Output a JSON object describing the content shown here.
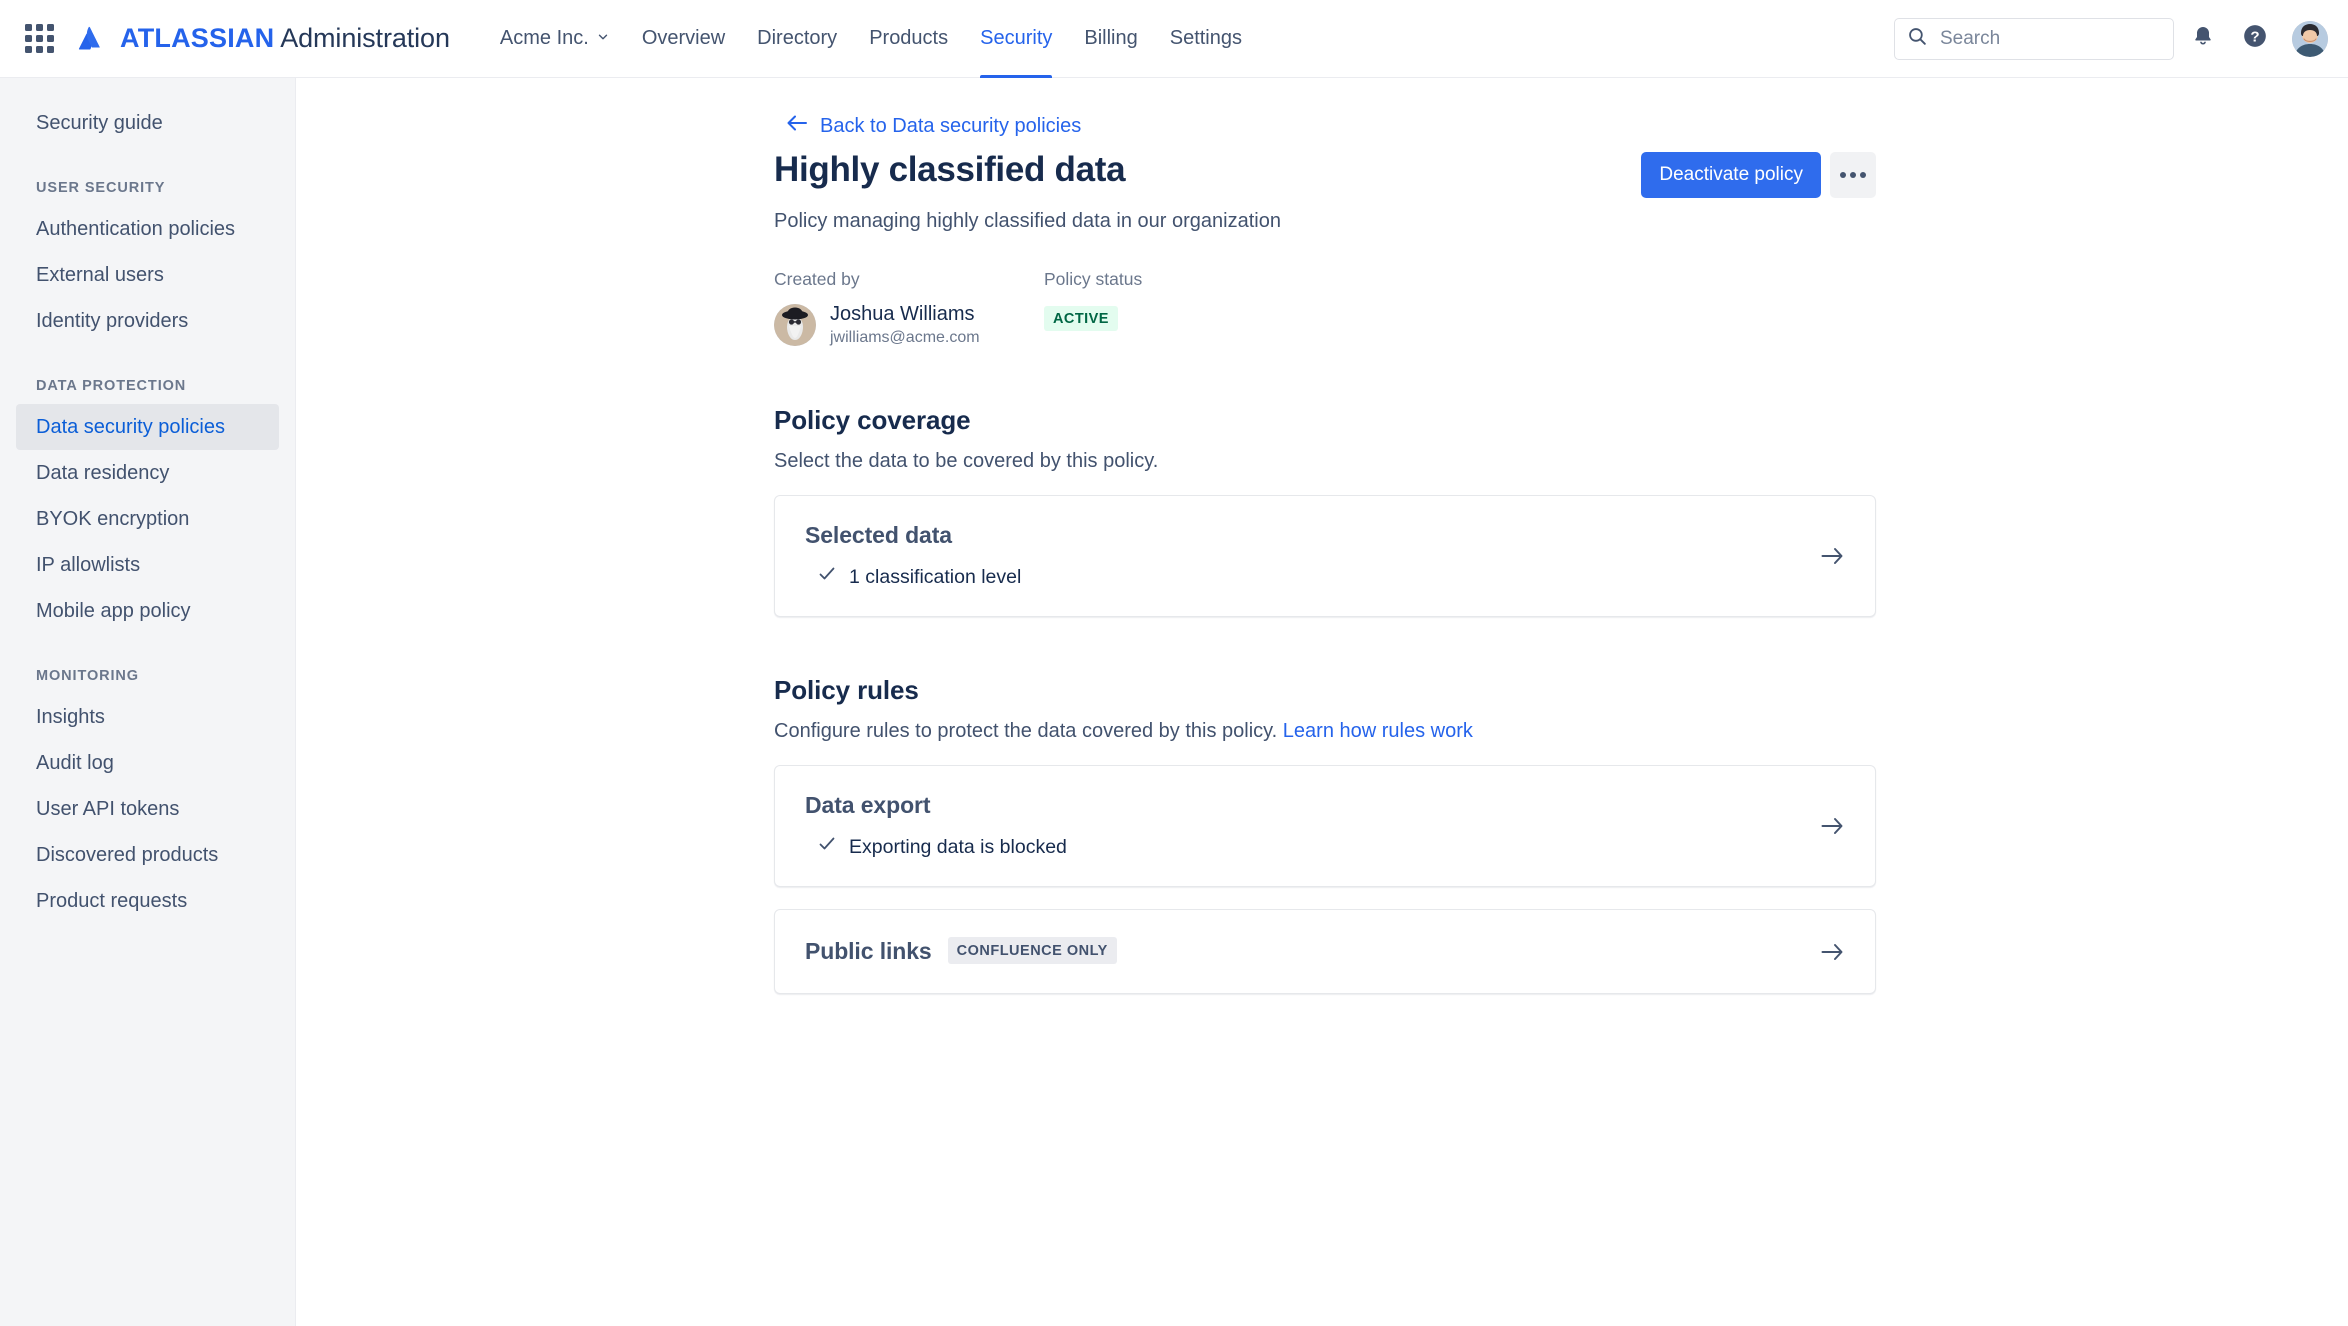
{
  "topnav": {
    "app_switcher_icon": "grid-apps-icon",
    "logo_icon": "atlassian-logo-icon",
    "brand_bold": "ATLASSIAN",
    "brand_light": "Administration",
    "org_name": "Acme Inc.",
    "links": [
      {
        "label": "Overview",
        "active": false
      },
      {
        "label": "Directory",
        "active": false
      },
      {
        "label": "Products",
        "active": false
      },
      {
        "label": "Security",
        "active": true
      },
      {
        "label": "Billing",
        "active": false
      },
      {
        "label": "Settings",
        "active": false
      }
    ],
    "search": {
      "placeholder": "Search",
      "value": "",
      "icon": "search-icon"
    },
    "notifications_icon": "bell-icon",
    "help_icon": "question-circle-icon",
    "profile_icon": "user-avatar"
  },
  "sidebar": {
    "top_items": [
      {
        "label": "Security guide",
        "selected": false
      }
    ],
    "groups": [
      {
        "title": "USER SECURITY",
        "items": [
          {
            "label": "Authentication policies",
            "selected": false
          },
          {
            "label": "External users",
            "selected": false
          },
          {
            "label": "Identity providers",
            "selected": false
          }
        ]
      },
      {
        "title": "DATA PROTECTION",
        "items": [
          {
            "label": "Data security policies",
            "selected": true
          },
          {
            "label": "Data residency",
            "selected": false
          },
          {
            "label": "BYOK encryption",
            "selected": false
          },
          {
            "label": "IP allowlists",
            "selected": false
          },
          {
            "label": "Mobile app policy",
            "selected": false
          }
        ]
      },
      {
        "title": "MONITORING",
        "items": [
          {
            "label": "Insights",
            "selected": false
          },
          {
            "label": "Audit log",
            "selected": false
          },
          {
            "label": "User API tokens",
            "selected": false
          },
          {
            "label": "Discovered products",
            "selected": false
          },
          {
            "label": "Product requests",
            "selected": false
          }
        ]
      }
    ]
  },
  "page": {
    "back_link": "Back to Data security policies",
    "back_icon": "arrow-left-icon",
    "title": "Highly classified data",
    "subtitle": "Policy managing highly classified data in our organization",
    "primary_button": "Deactivate policy",
    "more_button_icon": "more-horizontal-icon",
    "created_by_label": "Created by",
    "creator_name": "Joshua Williams",
    "creator_email": "jwilliams@acme.com",
    "policy_status_label": "Policy status",
    "policy_status_value": "ACTIVE"
  },
  "coverage": {
    "title": "Policy coverage",
    "description": "Select the data to be covered by this policy.",
    "card": {
      "title": "Selected data",
      "check_icon": "check-icon",
      "detail": "1 classification level",
      "arrow_icon": "arrow-right-icon"
    }
  },
  "rules": {
    "title": "Policy rules",
    "description": "Configure rules to protect the data covered by this policy.",
    "link_text": "Learn how rules work",
    "cards": [
      {
        "title": "Data export",
        "check_icon": "check-icon",
        "detail": "Exporting data is blocked",
        "badge": "",
        "arrow_icon": "arrow-right-icon"
      },
      {
        "title": "Public links",
        "check_icon": "",
        "detail": "",
        "badge": "CONFLUENCE ONLY",
        "arrow_icon": "arrow-right-icon"
      }
    ]
  },
  "colors": {
    "brand_blue": "#2563eb",
    "primary_button": "#2f6ced",
    "status_active_bg": "#e3fcef",
    "status_active_fg": "#006644",
    "sidebar_bg": "#f4f5f7",
    "text_primary": "#172b4d",
    "text_secondary": "#6b778c"
  }
}
